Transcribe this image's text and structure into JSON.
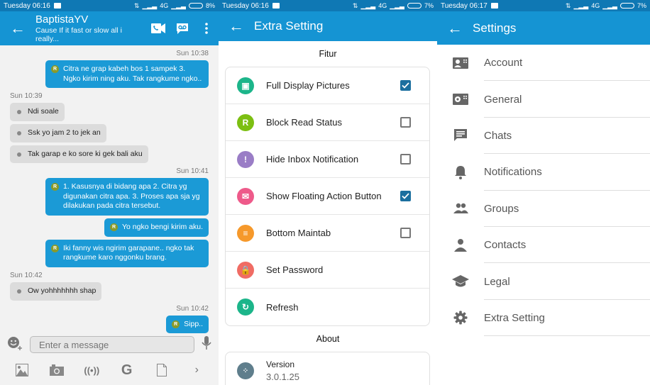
{
  "colors": {
    "status_bar": "#0f78b4",
    "app_bar": "#1594d3",
    "outgoing_bubble": "#1b9ad6",
    "incoming_bubble": "#dcdcdc",
    "checkbox_checked": "#1b6f9f"
  },
  "chat_screen": {
    "status": {
      "time": "Tuesday 06:16",
      "network": "4G",
      "battery": "8%"
    },
    "header": {
      "back_icon": "arrow-left-icon",
      "contact_name": "BaptistaYV",
      "status_message": "Cause If it fast or slow all i really...",
      "actions": [
        "video-call-icon",
        "voice-chat-icon",
        "more-vert-icon"
      ]
    },
    "messages": [
      {
        "direction": "out",
        "timestamp": "Sun 10:38",
        "text": "Citra ne grap kabeh bos 1 sampek 3. Ngko kirim ning aku. Tak rangkume ngko..",
        "badge": "R"
      },
      {
        "direction": "in",
        "timestamp": "Sun 10:39",
        "text": "Ndi soale"
      },
      {
        "direction": "in",
        "timestamp": "",
        "text": "Ssk yo jam 2 to jek an"
      },
      {
        "direction": "in",
        "timestamp": "",
        "text": "Tak garap e ko sore ki gek bali aku"
      },
      {
        "direction": "out",
        "timestamp": "Sun 10:41",
        "text": "1. Kasusnya di bidang apa 2. Citra yg digunakan citra apa. 3. Proses apa sja yg dilakukan pada citra tersebut.",
        "badge": "R"
      },
      {
        "direction": "out",
        "timestamp": "",
        "text": "Yo ngko bengi kirim aku.",
        "badge": "R"
      },
      {
        "direction": "out",
        "timestamp": "",
        "text": "Iki fanny wis ngirim garapane.. ngko tak rangkume karo nggonku brang.",
        "badge": "R"
      },
      {
        "direction": "in",
        "timestamp": "Sun 10:42",
        "text": "Ow yohhhhhhh shap"
      },
      {
        "direction": "out",
        "timestamp": "Sun 10:42",
        "text": "Sipp..",
        "badge": "R"
      }
    ],
    "composer": {
      "placeholder": "Enter a message",
      "value": "",
      "emoji_icon": "emoji-add-icon",
      "mic_icon": "microphone-icon"
    },
    "toolbar": [
      "image-icon",
      "camera-icon",
      "broadcast-icon",
      "google-icon",
      "file-icon",
      "chevron-right-icon"
    ]
  },
  "extra_setting_screen": {
    "status": {
      "time": "Tuesday 06:16",
      "network": "4G",
      "battery": "7%"
    },
    "title": "Extra Setting",
    "fitur_heading": "Fitur",
    "items": [
      {
        "label": "Full Display Pictures",
        "icon": "display-picture-icon",
        "color": "#1cb58a",
        "glyph": "▣",
        "checkbox": true,
        "checked": true
      },
      {
        "label": "Block Read Status",
        "icon": "read-status-icon",
        "color": "#7cbf12",
        "glyph": "R",
        "checkbox": true,
        "checked": false
      },
      {
        "label": "Hide Inbox Notification",
        "icon": "notification-icon",
        "color": "#9a7dc6",
        "glyph": "!",
        "checkbox": true,
        "checked": false
      },
      {
        "label": "Show Floating Action Button",
        "icon": "floating-button-icon",
        "color": "#ee5a8a",
        "glyph": "✉",
        "checkbox": true,
        "checked": true
      },
      {
        "label": "Bottom Maintab",
        "icon": "menu-icon",
        "color": "#f6992b",
        "glyph": "≡",
        "checkbox": true,
        "checked": false
      },
      {
        "label": "Set Password",
        "icon": "lock-icon",
        "color": "#f06c64",
        "glyph": "🔒",
        "checkbox": false
      },
      {
        "label": "Refresh",
        "icon": "refresh-icon",
        "color": "#1cb58a",
        "glyph": "↻",
        "checkbox": false
      }
    ],
    "about_heading": "About",
    "version_label": "Version",
    "version_value": "3.0.1.25"
  },
  "settings_screen": {
    "status": {
      "time": "Tuesday 06:17",
      "network": "4G",
      "battery": "7%"
    },
    "title": "Settings",
    "items": [
      {
        "label": "Account",
        "icon": "account-icon"
      },
      {
        "label": "General",
        "icon": "general-settings-icon"
      },
      {
        "label": "Chats",
        "icon": "chat-icon"
      },
      {
        "label": "Notifications",
        "icon": "bell-icon"
      },
      {
        "label": "Groups",
        "icon": "groups-icon"
      },
      {
        "label": "Contacts",
        "icon": "contact-icon"
      },
      {
        "label": "Legal",
        "icon": "legal-icon"
      },
      {
        "label": "Extra Setting",
        "icon": "gear-icon"
      }
    ]
  }
}
